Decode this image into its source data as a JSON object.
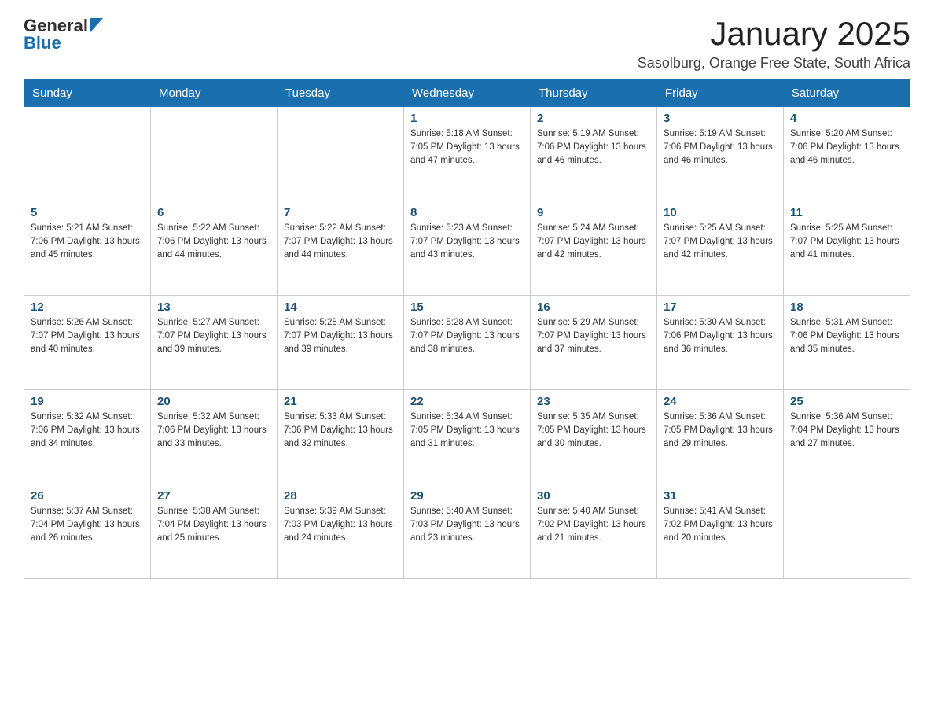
{
  "header": {
    "logo_general": "General",
    "logo_blue": "Blue",
    "title": "January 2025",
    "subtitle": "Sasolburg, Orange Free State, South Africa"
  },
  "days_of_week": [
    "Sunday",
    "Monday",
    "Tuesday",
    "Wednesday",
    "Thursday",
    "Friday",
    "Saturday"
  ],
  "weeks": [
    [
      {
        "day": "",
        "info": ""
      },
      {
        "day": "",
        "info": ""
      },
      {
        "day": "",
        "info": ""
      },
      {
        "day": "1",
        "info": "Sunrise: 5:18 AM\nSunset: 7:05 PM\nDaylight: 13 hours\nand 47 minutes."
      },
      {
        "day": "2",
        "info": "Sunrise: 5:19 AM\nSunset: 7:06 PM\nDaylight: 13 hours\nand 46 minutes."
      },
      {
        "day": "3",
        "info": "Sunrise: 5:19 AM\nSunset: 7:06 PM\nDaylight: 13 hours\nand 46 minutes."
      },
      {
        "day": "4",
        "info": "Sunrise: 5:20 AM\nSunset: 7:06 PM\nDaylight: 13 hours\nand 46 minutes."
      }
    ],
    [
      {
        "day": "5",
        "info": "Sunrise: 5:21 AM\nSunset: 7:06 PM\nDaylight: 13 hours\nand 45 minutes."
      },
      {
        "day": "6",
        "info": "Sunrise: 5:22 AM\nSunset: 7:06 PM\nDaylight: 13 hours\nand 44 minutes."
      },
      {
        "day": "7",
        "info": "Sunrise: 5:22 AM\nSunset: 7:07 PM\nDaylight: 13 hours\nand 44 minutes."
      },
      {
        "day": "8",
        "info": "Sunrise: 5:23 AM\nSunset: 7:07 PM\nDaylight: 13 hours\nand 43 minutes."
      },
      {
        "day": "9",
        "info": "Sunrise: 5:24 AM\nSunset: 7:07 PM\nDaylight: 13 hours\nand 42 minutes."
      },
      {
        "day": "10",
        "info": "Sunrise: 5:25 AM\nSunset: 7:07 PM\nDaylight: 13 hours\nand 42 minutes."
      },
      {
        "day": "11",
        "info": "Sunrise: 5:25 AM\nSunset: 7:07 PM\nDaylight: 13 hours\nand 41 minutes."
      }
    ],
    [
      {
        "day": "12",
        "info": "Sunrise: 5:26 AM\nSunset: 7:07 PM\nDaylight: 13 hours\nand 40 minutes."
      },
      {
        "day": "13",
        "info": "Sunrise: 5:27 AM\nSunset: 7:07 PM\nDaylight: 13 hours\nand 39 minutes."
      },
      {
        "day": "14",
        "info": "Sunrise: 5:28 AM\nSunset: 7:07 PM\nDaylight: 13 hours\nand 39 minutes."
      },
      {
        "day": "15",
        "info": "Sunrise: 5:28 AM\nSunset: 7:07 PM\nDaylight: 13 hours\nand 38 minutes."
      },
      {
        "day": "16",
        "info": "Sunrise: 5:29 AM\nSunset: 7:07 PM\nDaylight: 13 hours\nand 37 minutes."
      },
      {
        "day": "17",
        "info": "Sunrise: 5:30 AM\nSunset: 7:06 PM\nDaylight: 13 hours\nand 36 minutes."
      },
      {
        "day": "18",
        "info": "Sunrise: 5:31 AM\nSunset: 7:06 PM\nDaylight: 13 hours\nand 35 minutes."
      }
    ],
    [
      {
        "day": "19",
        "info": "Sunrise: 5:32 AM\nSunset: 7:06 PM\nDaylight: 13 hours\nand 34 minutes."
      },
      {
        "day": "20",
        "info": "Sunrise: 5:32 AM\nSunset: 7:06 PM\nDaylight: 13 hours\nand 33 minutes."
      },
      {
        "day": "21",
        "info": "Sunrise: 5:33 AM\nSunset: 7:06 PM\nDaylight: 13 hours\nand 32 minutes."
      },
      {
        "day": "22",
        "info": "Sunrise: 5:34 AM\nSunset: 7:05 PM\nDaylight: 13 hours\nand 31 minutes."
      },
      {
        "day": "23",
        "info": "Sunrise: 5:35 AM\nSunset: 7:05 PM\nDaylight: 13 hours\nand 30 minutes."
      },
      {
        "day": "24",
        "info": "Sunrise: 5:36 AM\nSunset: 7:05 PM\nDaylight: 13 hours\nand 29 minutes."
      },
      {
        "day": "25",
        "info": "Sunrise: 5:36 AM\nSunset: 7:04 PM\nDaylight: 13 hours\nand 27 minutes."
      }
    ],
    [
      {
        "day": "26",
        "info": "Sunrise: 5:37 AM\nSunset: 7:04 PM\nDaylight: 13 hours\nand 26 minutes."
      },
      {
        "day": "27",
        "info": "Sunrise: 5:38 AM\nSunset: 7:04 PM\nDaylight: 13 hours\nand 25 minutes."
      },
      {
        "day": "28",
        "info": "Sunrise: 5:39 AM\nSunset: 7:03 PM\nDaylight: 13 hours\nand 24 minutes."
      },
      {
        "day": "29",
        "info": "Sunrise: 5:40 AM\nSunset: 7:03 PM\nDaylight: 13 hours\nand 23 minutes."
      },
      {
        "day": "30",
        "info": "Sunrise: 5:40 AM\nSunset: 7:02 PM\nDaylight: 13 hours\nand 21 minutes."
      },
      {
        "day": "31",
        "info": "Sunrise: 5:41 AM\nSunset: 7:02 PM\nDaylight: 13 hours\nand 20 minutes."
      },
      {
        "day": "",
        "info": ""
      }
    ]
  ]
}
